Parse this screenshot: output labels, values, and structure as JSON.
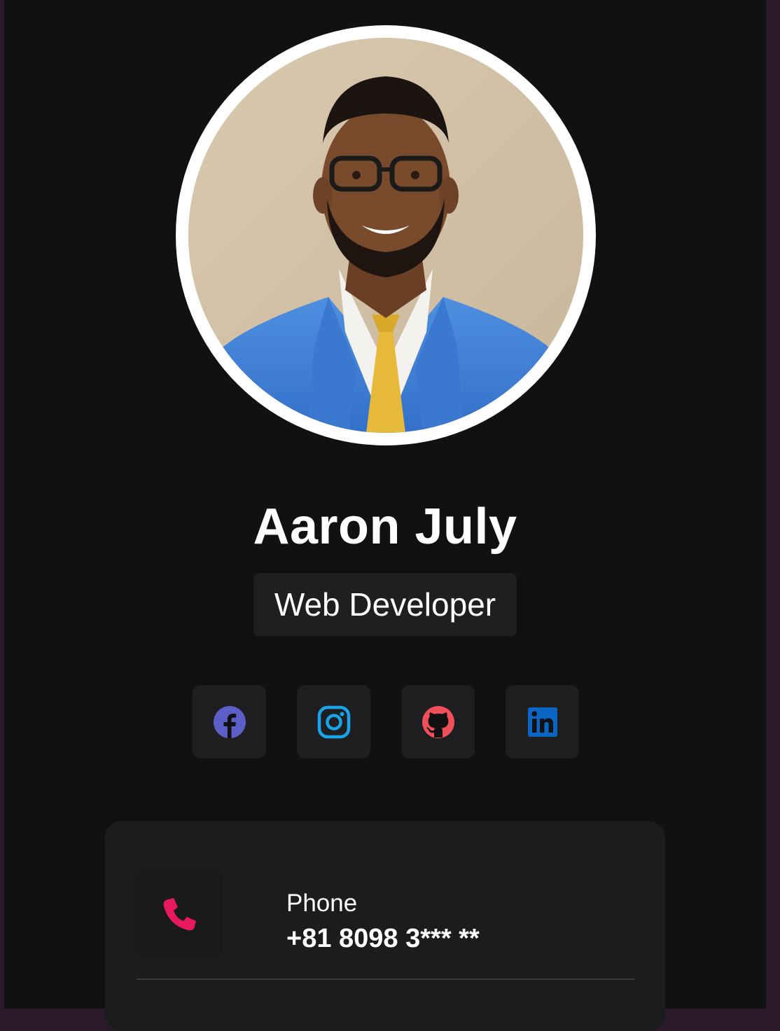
{
  "profile": {
    "name": "Aaron July",
    "role": "Web Developer",
    "avatar_alt": "avatar-photo"
  },
  "socials": [
    {
      "network": "Facebook",
      "icon": "facebook-icon",
      "color": "#5b5fc7"
    },
    {
      "network": "Instagram",
      "icon": "instagram-icon",
      "color": "#1aa4e8"
    },
    {
      "network": "GitHub",
      "icon": "github-icon",
      "color": "#f0505a"
    },
    {
      "network": "LinkedIn",
      "icon": "linkedin-icon",
      "color": "#0a66c2"
    }
  ],
  "contacts": [
    {
      "label": "Phone",
      "value": "+81 8098 3*** **",
      "icon": "phone-icon",
      "color": "#e8195e"
    }
  ],
  "colors": {
    "background": "#111113",
    "card": "#1c1c1f",
    "chip": "#1f1f22",
    "text": "#ffffff"
  }
}
